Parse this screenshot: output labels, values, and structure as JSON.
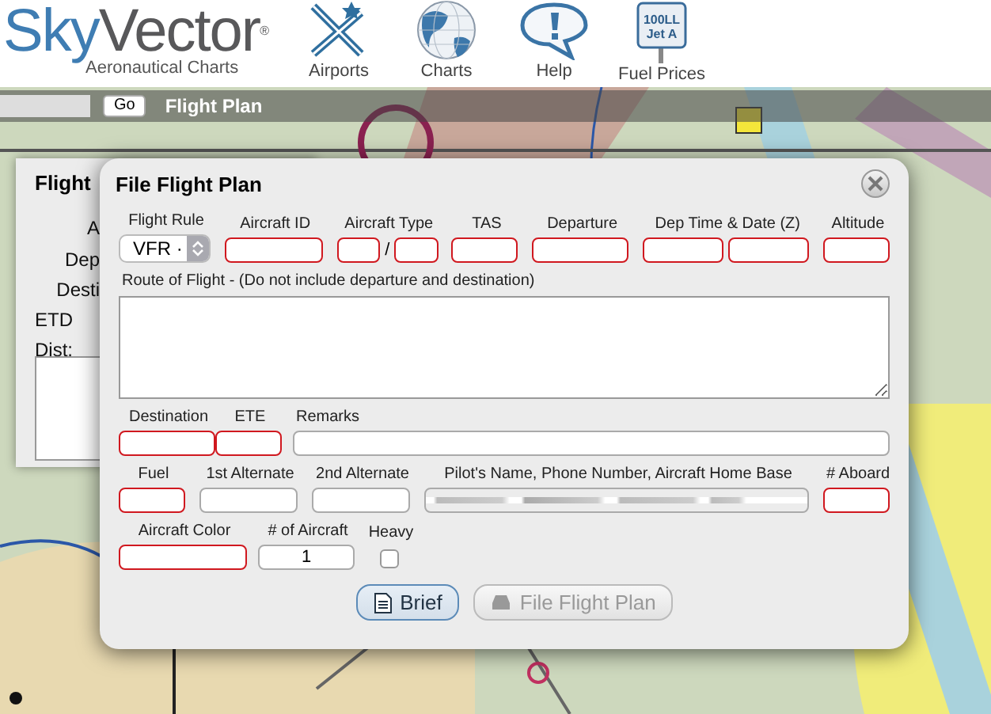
{
  "header": {
    "brand_first": "Sky",
    "brand_rest": "Vector",
    "brand_mark": "®",
    "tagline": "Aeronautical Charts",
    "nav": [
      {
        "kind": "airport",
        "label": "Airports"
      },
      {
        "kind": "globe",
        "label": "Charts"
      },
      {
        "kind": "help",
        "label": "Help"
      },
      {
        "kind": "fuel",
        "label": "Fuel Prices",
        "sign": [
          "100LL",
          "Jet A"
        ]
      }
    ]
  },
  "toolbar": {
    "go_button": "Go",
    "title": "Flight Plan"
  },
  "back_panel": {
    "title": "Flight",
    "labels": [
      "A",
      "Dep",
      "Desti",
      "ETD",
      "Dist:"
    ]
  },
  "dialog": {
    "title": "File Flight Plan",
    "rows": [
      {
        "fields": [
          {
            "kind": "select",
            "label": "Flight Rule",
            "value": "VFR ·"
          },
          {
            "kind": "text",
            "label": "Aircraft ID",
            "inputs": [
              {
                "required": true
              }
            ]
          },
          {
            "kind": "text",
            "label": "Aircraft Type",
            "separator": "/",
            "inputs": [
              {
                "required": true
              },
              {
                "required": true
              }
            ]
          },
          {
            "kind": "text",
            "label": "TAS",
            "inputs": [
              {
                "required": true
              }
            ]
          },
          {
            "kind": "text",
            "label": "Departure",
            "inputs": [
              {
                "required": true
              }
            ]
          },
          {
            "kind": "text",
            "label": "Dep Time & Date (Z)",
            "inputs": [
              {
                "required": true
              },
              {
                "required": true
              }
            ]
          },
          {
            "kind": "text",
            "label": "Altitude",
            "inputs": [
              {
                "required": true
              }
            ]
          }
        ]
      },
      {
        "fields": [
          {
            "kind": "textarea",
            "label": "Route of Flight - (Do not include departure and destination)"
          }
        ]
      },
      {
        "fields": [
          {
            "kind": "text",
            "label": "Destination",
            "inputs": [
              {
                "required": true
              }
            ]
          },
          {
            "kind": "text",
            "label": "ETE",
            "inputs": [
              {
                "required": true
              }
            ]
          },
          {
            "kind": "text",
            "label": "Remarks",
            "inputs": [
              {
                "required": false
              }
            ]
          }
        ]
      },
      {
        "fields": [
          {
            "kind": "text",
            "label": "Fuel",
            "inputs": [
              {
                "required": true
              }
            ]
          },
          {
            "kind": "text",
            "label": "1st Alternate",
            "inputs": [
              {
                "required": false
              }
            ]
          },
          {
            "kind": "text",
            "label": "2nd Alternate",
            "inputs": [
              {
                "required": false
              }
            ]
          },
          {
            "kind": "text",
            "label": "Pilot's Name, Phone Number, Aircraft Home Base",
            "inputs": [
              {
                "required": false,
                "blurred": true
              }
            ]
          },
          {
            "kind": "text",
            "label": "# Aboard",
            "inputs": [
              {
                "required": true
              }
            ]
          }
        ]
      },
      {
        "fields": [
          {
            "kind": "text",
            "label": "Aircraft Color",
            "inputs": [
              {
                "required": true
              }
            ]
          },
          {
            "kind": "text",
            "label": "# of Aircraft",
            "inputs": [
              {
                "required": false,
                "value": "1"
              }
            ]
          },
          {
            "kind": "checkbox",
            "label": "Heavy",
            "checked": false
          }
        ]
      }
    ],
    "buttons": [
      {
        "kind": "brief",
        "label": "Brief",
        "disabled": false
      },
      {
        "kind": "file",
        "label": "File Flight Plan",
        "disabled": true
      }
    ]
  }
}
